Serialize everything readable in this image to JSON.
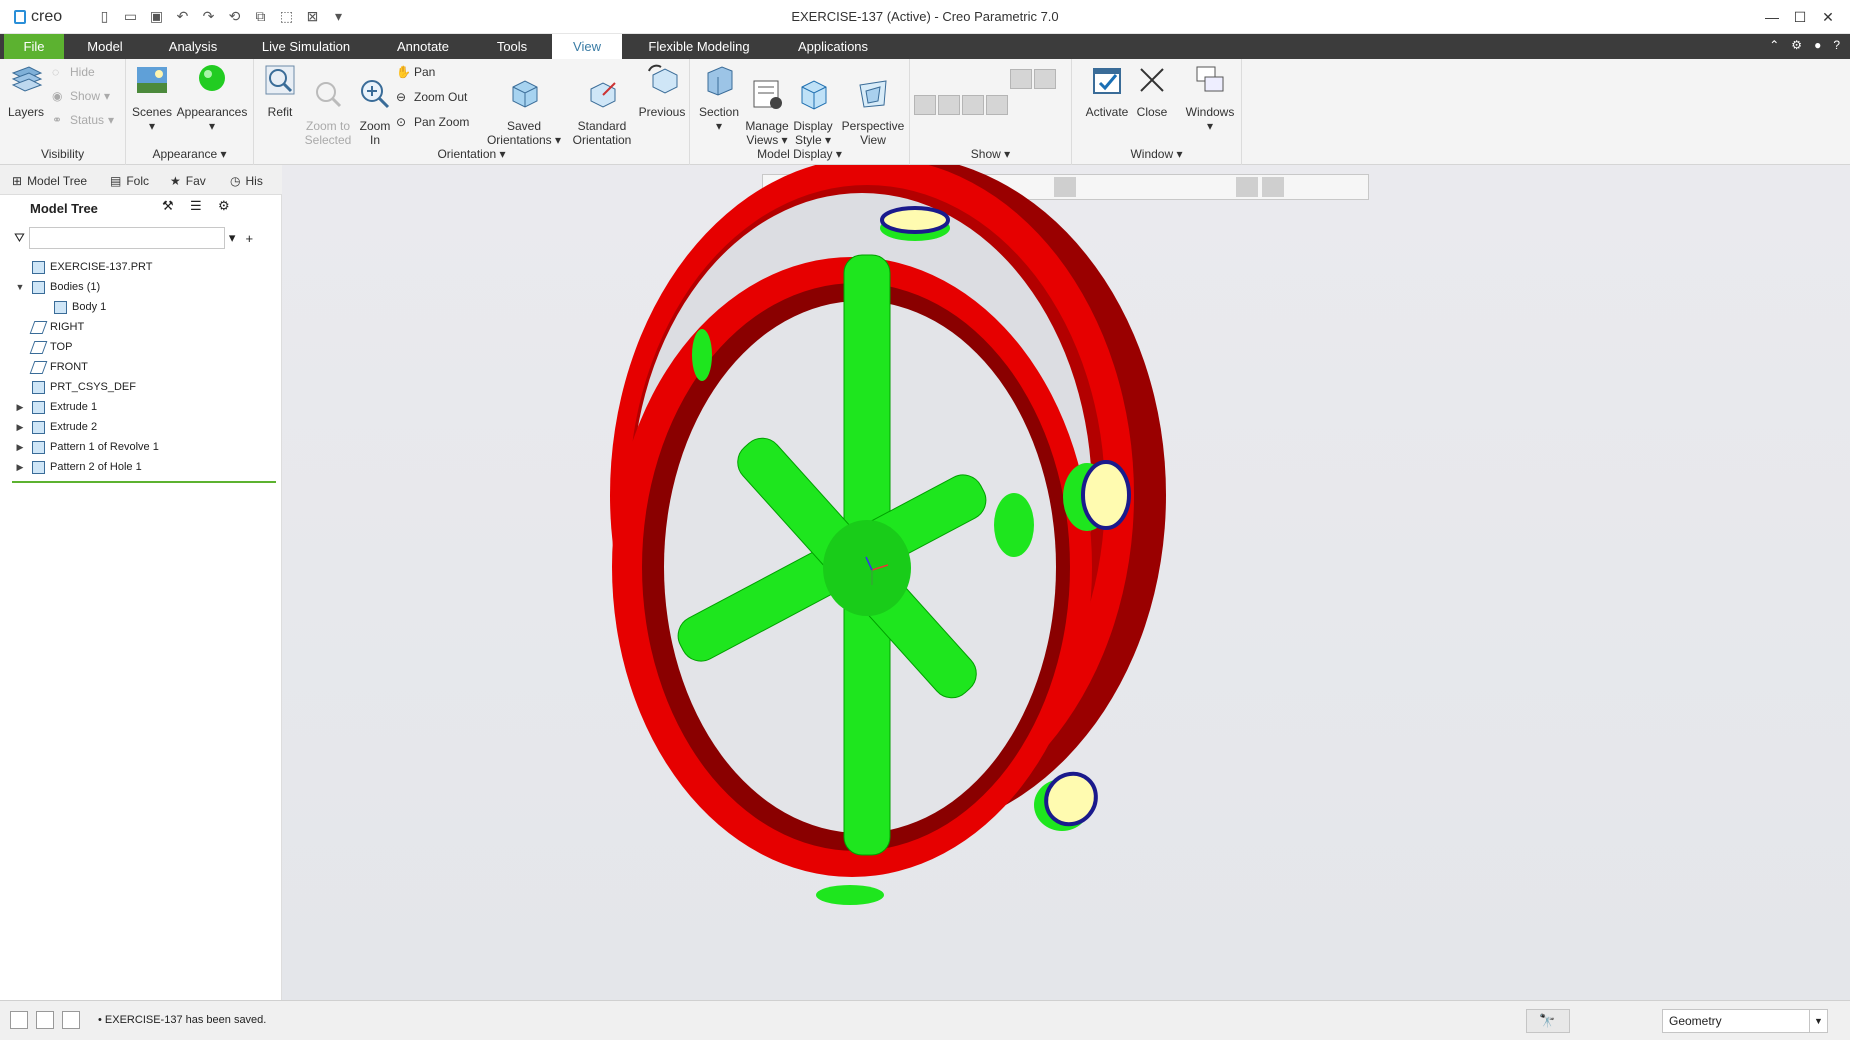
{
  "app": {
    "logo_text": "creo",
    "window_title": "EXERCISE-137 (Active) - Creo Parametric 7.0",
    "controls": {
      "minimize": "—",
      "maximize": "☐",
      "close": "✕"
    }
  },
  "ribbon": {
    "tabs": [
      "File",
      "Model",
      "Analysis",
      "Live Simulation",
      "Annotate",
      "Tools",
      "View",
      "Flexible Modeling",
      "Applications"
    ],
    "active_tab": "View",
    "visibility": {
      "label": "Visibility",
      "layers": "Layers",
      "hide": "Hide",
      "show": "Show",
      "status": "Status"
    },
    "appearance": {
      "label": "Appearance",
      "scenes": "Scenes",
      "appearances": "Appearances"
    },
    "orientation": {
      "label": "Orientation",
      "refit": "Refit",
      "zoom_to_selected": "Zoom to\nSelected",
      "zoom_in": "Zoom\nIn",
      "pan": "Pan",
      "zoom_out": "Zoom Out",
      "pan_zoom": "Pan Zoom",
      "saved_orientations": "Saved\nOrientations",
      "standard_orientation": "Standard\nOrientation",
      "previous": "Previous"
    },
    "model_display": {
      "label": "Model Display",
      "section": "Section",
      "manage_views": "Manage\nViews",
      "display_style": "Display\nStyle",
      "perspective_view": "Perspective\nView"
    },
    "show": {
      "label": "Show"
    },
    "window": {
      "label": "Window",
      "activate": "Activate",
      "close": "Close",
      "windows": "Windows"
    }
  },
  "panel": {
    "tabs": [
      "Model Tree",
      "Folc",
      "Fav",
      "His"
    ],
    "title": "Model Tree",
    "search_value": "",
    "tree": [
      {
        "label": "EXERCISE-137.PRT",
        "level": 0,
        "expander": "",
        "icon": "part-icon"
      },
      {
        "label": "Bodies (1)",
        "level": 0,
        "expander": "▼",
        "icon": "bodies-icon"
      },
      {
        "label": "Body 1",
        "level": 1,
        "expander": "",
        "icon": "body-icon"
      },
      {
        "label": "RIGHT",
        "level": 0,
        "expander": "",
        "icon": "datum-plane-icon"
      },
      {
        "label": "TOP",
        "level": 0,
        "expander": "",
        "icon": "datum-plane-icon"
      },
      {
        "label": "FRONT",
        "level": 0,
        "expander": "",
        "icon": "datum-plane-icon"
      },
      {
        "label": "PRT_CSYS_DEF",
        "level": 0,
        "expander": "",
        "icon": "csys-icon"
      },
      {
        "label": "Extrude 1",
        "level": 0,
        "expander": "▶",
        "icon": "extrude-icon"
      },
      {
        "label": "Extrude 2",
        "level": 0,
        "expander": "▶",
        "icon": "extrude-icon"
      },
      {
        "label": "Pattern 1 of Revolve 1",
        "level": 0,
        "expander": "▶",
        "icon": "pattern-icon"
      },
      {
        "label": "Pattern 2 of Hole 1",
        "level": 0,
        "expander": "▶",
        "icon": "pattern-icon"
      }
    ]
  },
  "model": {
    "ring_color": "#e60000",
    "ring_shadow": "#9a0000",
    "spoke_color": "#1ee61e",
    "hole_rim_color": "#1a1a8c",
    "hole_fill": "#fffbb0"
  },
  "status": {
    "message": "EXERCISE-137 has been saved.",
    "filter": "Geometry"
  }
}
